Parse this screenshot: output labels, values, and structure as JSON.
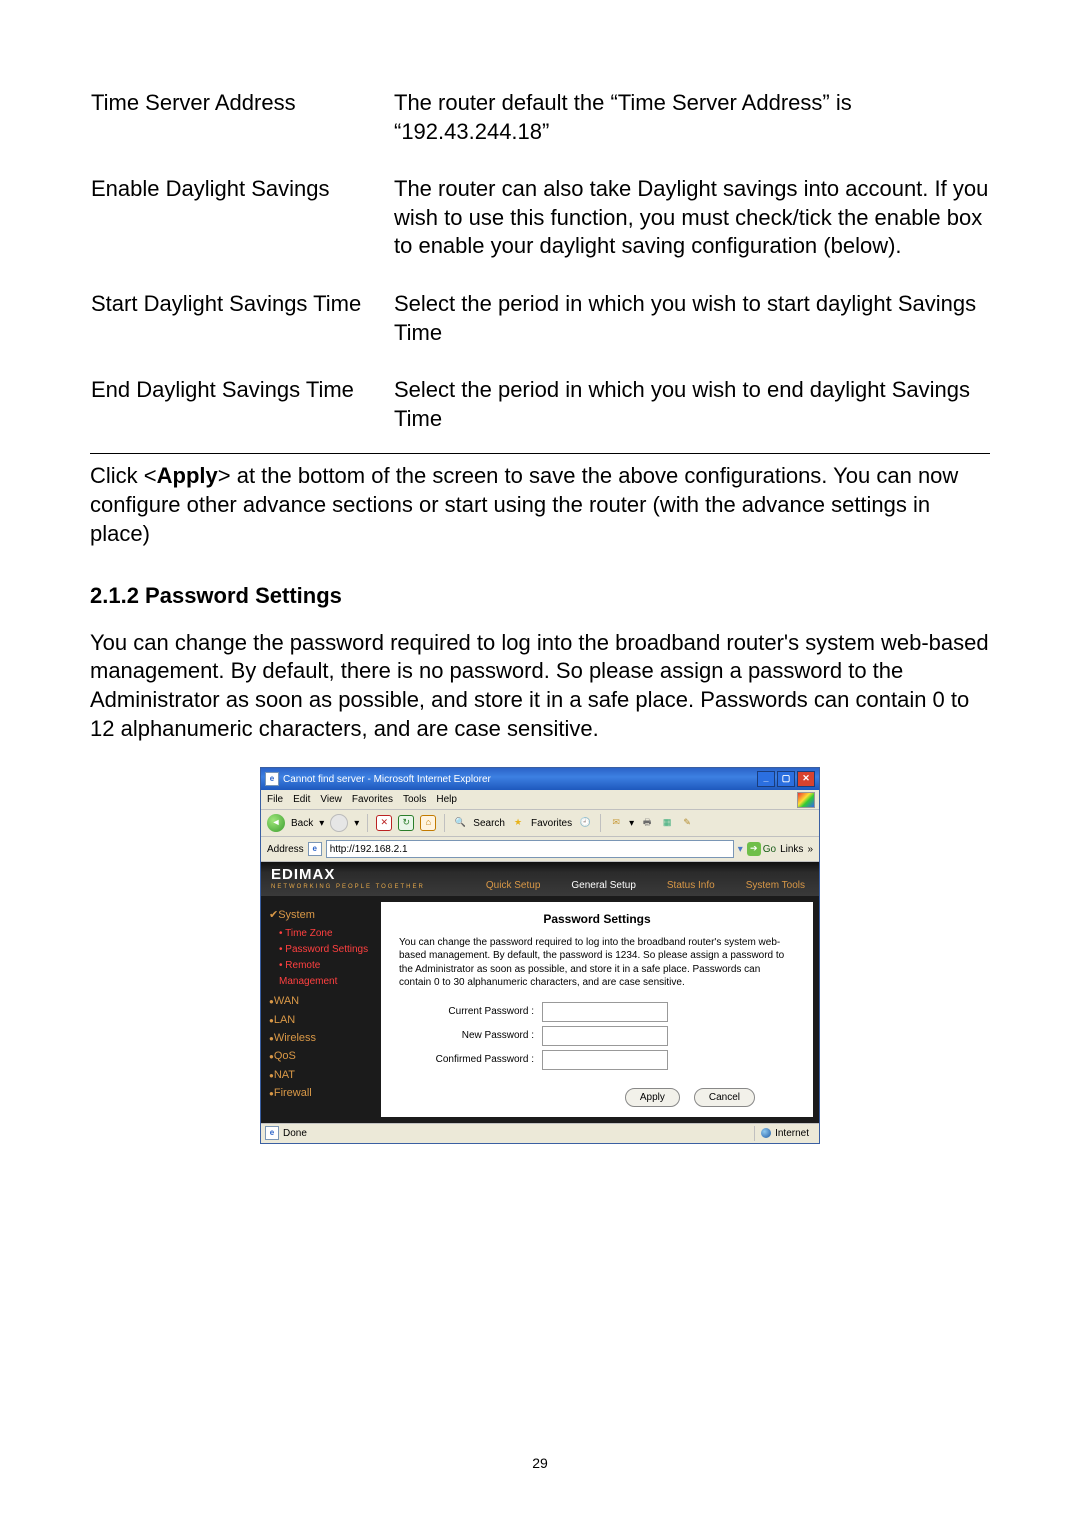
{
  "defs": [
    {
      "term": "Time Server Address",
      "desc": "The router default the “Time Server Address” is “192.43.244.18”"
    },
    {
      "term": "Enable Daylight Savings",
      "desc": "The router can also take Daylight savings into account. If you wish to use this function, you must check/tick the enable box to enable your daylight saving configuration (below)."
    },
    {
      "term": "Start Daylight Savings Time",
      "desc": "Select the period in which you wish to start daylight Savings Time"
    },
    {
      "term": "End Daylight Savings Time",
      "desc": "Select the period in which you wish to end daylight Savings Time"
    }
  ],
  "apply_note_pre": "Click <",
  "apply_note_bold": "Apply",
  "apply_note_post": "> at the bottom of the screen to save the above configurations. You can now configure other advance sections or start using the router (with the advance settings in place)",
  "section_heading": "2.1.2 Password Settings",
  "section_para": "You can change the password required to log into the broadband router's system web-based management. By default, there is no password. So please assign a password to the Administrator as soon as possible, and store it in a safe place. Passwords can contain 0 to 12 alphanumeric characters, and are case sensitive.",
  "ie": {
    "title": "Cannot find server - Microsoft Internet Explorer",
    "menu": [
      "File",
      "Edit",
      "View",
      "Favorites",
      "Tools",
      "Help"
    ],
    "toolbar": {
      "back": "Back",
      "search": "Search",
      "favorites": "Favorites"
    },
    "address_label": "Address",
    "address_value": "http://192.168.2.1",
    "go": "Go",
    "links": "Links",
    "status_done": "Done",
    "status_zone": "Internet"
  },
  "app": {
    "brand": "EDIMAX",
    "brand_sub": "NETWORKING PEOPLE TOGETHER",
    "topnav": [
      "Quick Setup",
      "General Setup",
      "Status Info",
      "System Tools"
    ],
    "sidebar": {
      "group1": "System",
      "group1_items": [
        "Time Zone",
        "Password Settings",
        "Remote Management"
      ],
      "others": [
        "WAN",
        "LAN",
        "Wireless",
        "QoS",
        "NAT",
        "Firewall"
      ]
    },
    "main": {
      "title": "Password Settings",
      "desc": "You can change the password required to log into the broadband router's system web-based management. By default, the password is 1234. So please assign a password to the Administrator as soon as possible, and store it in a safe place. Passwords can contain 0 to 30 alphanumeric characters, and are case sensitive.",
      "fields": {
        "current": "Current Password :",
        "new": "New Password :",
        "confirm": "Confirmed Password :"
      },
      "apply": "Apply",
      "cancel": "Cancel"
    }
  },
  "page_number": "29"
}
